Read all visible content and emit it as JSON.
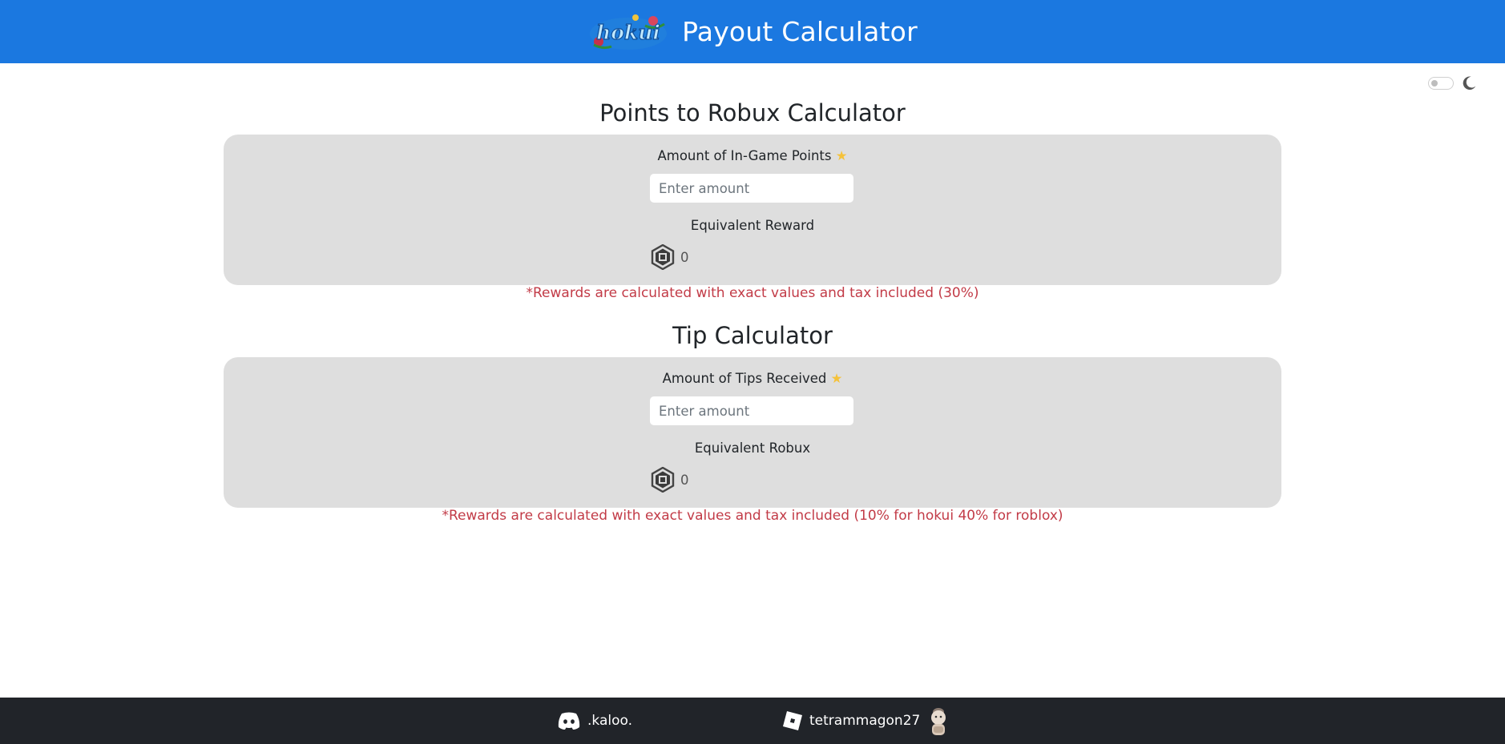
{
  "header": {
    "logo_text": "hokui",
    "title": "Payout Calculator"
  },
  "theme": {
    "toggle_icon": "moon-icon",
    "dark_mode": false
  },
  "points_calc": {
    "title": "Points to Robux Calculator",
    "input_label": "Amount of In-Game Points",
    "input_placeholder": "Enter amount",
    "result_label": "Equivalent Reward",
    "result_value": "0",
    "note": "*Rewards are calculated with exact values and tax included (30%)"
  },
  "tip_calc": {
    "title": "Tip Calculator",
    "input_label": "Amount of Tips Received",
    "input_placeholder": "Enter amount",
    "result_label": "Equivalent Robux",
    "result_value": "0",
    "note": "*Rewards are calculated with exact values and tax included (10% for hokui 40% for roblox)"
  },
  "footer": {
    "discord_name": ".kaloo.",
    "roblox_name": "tetrammagon27"
  },
  "colors": {
    "header_bg": "#1b78e0",
    "card_bg": "#dedede",
    "note": "#c23b47",
    "footer_bg": "#212429"
  }
}
